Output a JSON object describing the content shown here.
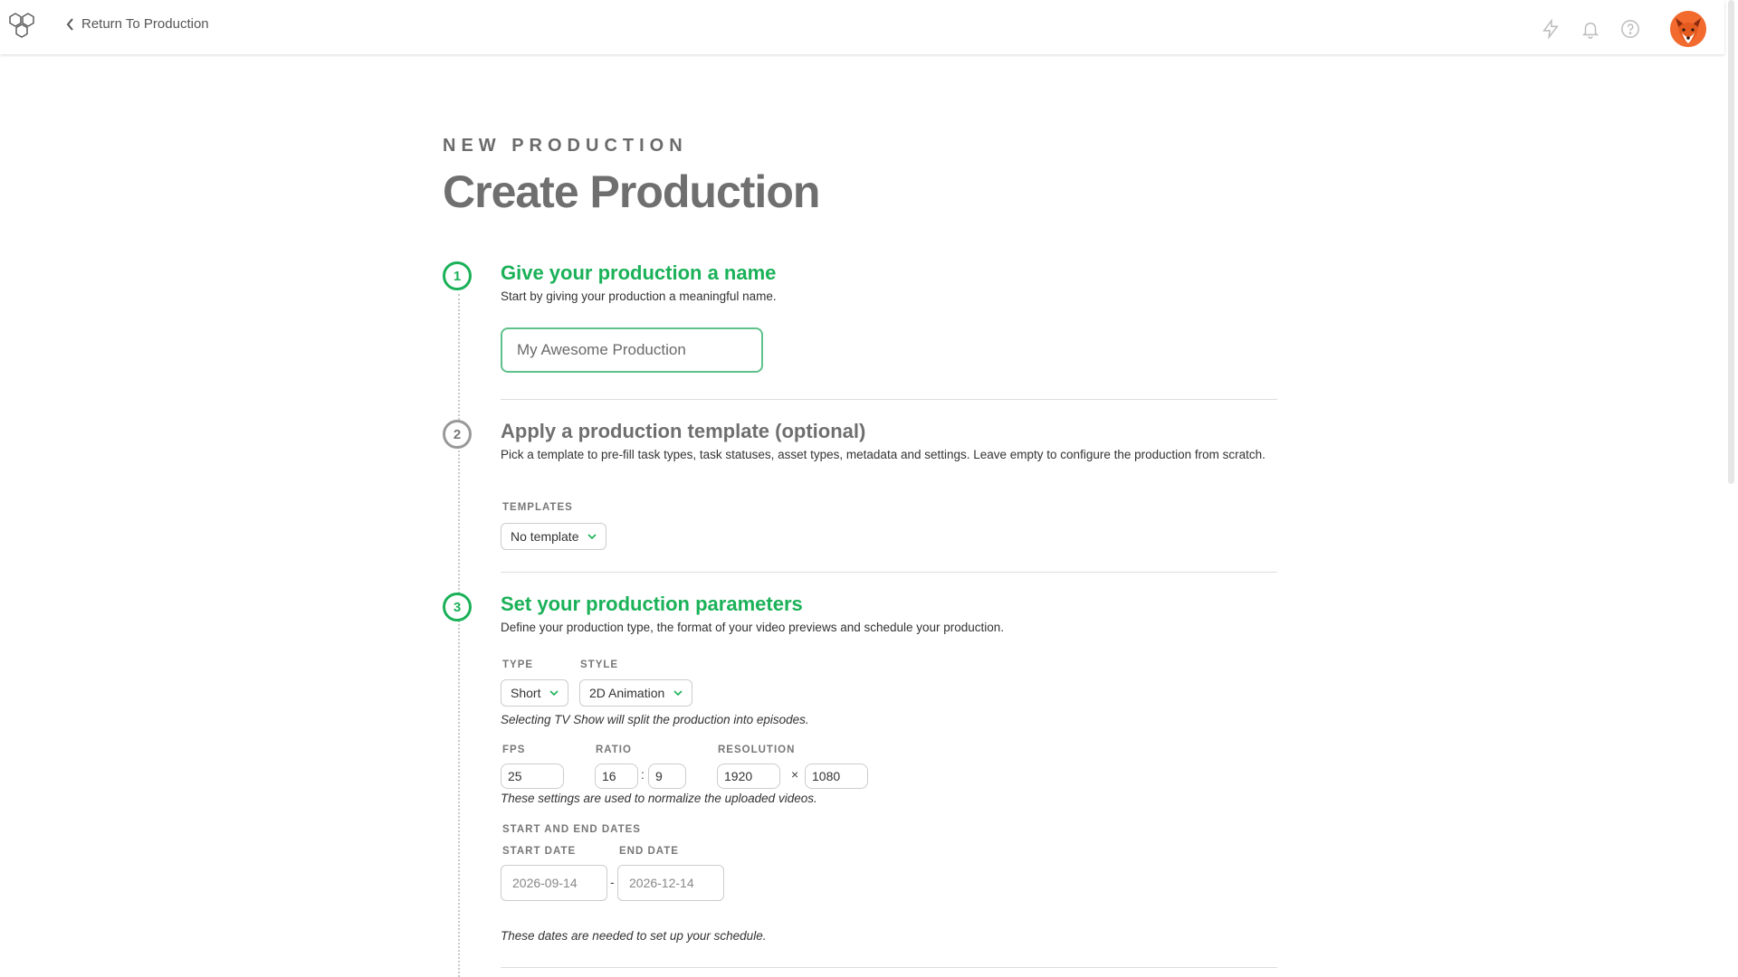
{
  "header": {
    "back_label": "Return To Production",
    "icons": [
      "logo-icon",
      "lightning-icon",
      "bell-icon",
      "help-icon",
      "avatar"
    ]
  },
  "page": {
    "overline": "NEW PRODUCTION",
    "title": "Create Production"
  },
  "steps": [
    {
      "number": "1",
      "title": "Give your production a name",
      "description": "Start by giving your production a meaningful name.",
      "name_placeholder": "My Awesome Production"
    },
    {
      "number": "2",
      "title": "Apply a production template (optional)",
      "description": "Pick a template to pre-fill task types, task statuses, asset types, metadata and settings. Leave empty to configure the production from scratch.",
      "templates_label": "TEMPLATES",
      "template_value": "No template"
    },
    {
      "number": "3",
      "title": "Set your production parameters",
      "description": "Define your production type, the format of your video previews and schedule your production.",
      "type_label": "TYPE",
      "type_value": "Short",
      "style_label": "STYLE",
      "style_value": "2D Animation",
      "type_hint": "Selecting TV Show will split the production into episodes.",
      "fps_label": "FPS",
      "fps_value": "25",
      "ratio_label": "RATIO",
      "ratio_w": "16",
      "ratio_sep": ":",
      "ratio_h": "9",
      "resolution_label": "RESOLUTION",
      "res_w": "1920",
      "res_sep": "×",
      "res_h": "1080",
      "format_hint": "These settings are used to normalize the uploaded videos.",
      "dates_label": "START AND END DATES",
      "start_label": "START DATE",
      "start_value": "2026-09-14",
      "date_sep": "-",
      "end_label": "END DATE",
      "end_value": "2026-12-14",
      "dates_hint": "These dates are needed to set up your schedule."
    }
  ],
  "colors": {
    "accent_green": "#1ab158",
    "avatar_orange": "#f26a2e"
  }
}
